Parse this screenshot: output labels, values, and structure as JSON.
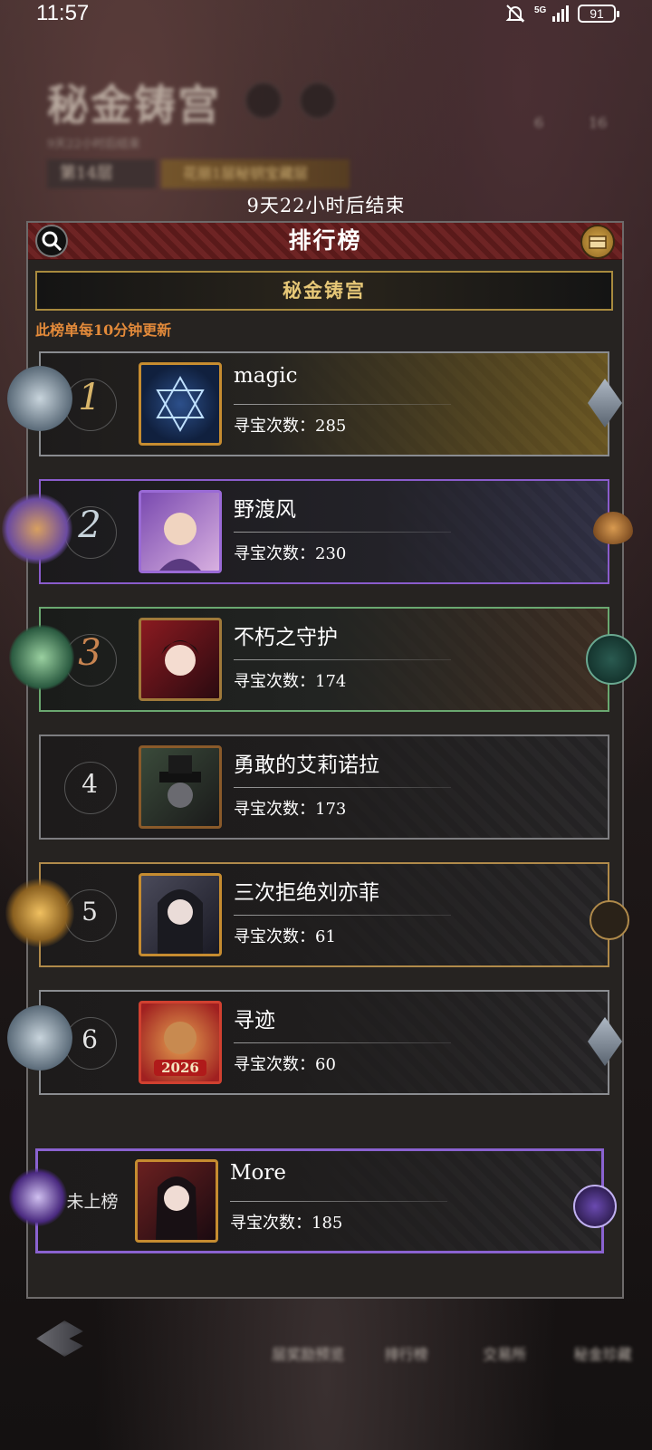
{
  "status": {
    "time": "11:57",
    "network": "5G",
    "battery": "91"
  },
  "background": {
    "title": "秘金铸宫",
    "subtitle": "9天22小时后结束",
    "floor": "第14层",
    "banner": "花丽1层秘钥宝藏层",
    "resource_1": "6",
    "resource_2": "16"
  },
  "countdown": "9天22小时后结束",
  "panel": {
    "title": "排行榜",
    "subtab": "秘金铸宫",
    "update_note": "此榜单每10分钟更新"
  },
  "rows": [
    {
      "rank": "1",
      "name": "magic",
      "score": "寻宝次数：285"
    },
    {
      "rank": "2",
      "name": "野渡风",
      "score": "寻宝次数：230"
    },
    {
      "rank": "3",
      "name": "不朽之守护",
      "score": "寻宝次数：174"
    },
    {
      "rank": "4",
      "name": "勇敢的艾莉诺拉",
      "score": "寻宝次数：173"
    },
    {
      "rank": "5",
      "name": "三次拒绝刘亦菲",
      "score": "寻宝次数：61"
    },
    {
      "rank": "6",
      "name": "寻迹",
      "score": "寻宝次数：60"
    }
  ],
  "self_row": {
    "rank": "未上榜",
    "name": "More",
    "score": "寻宝次数：185"
  },
  "avatar_badge": "2026",
  "bottom_nav": [
    "层奖励预览",
    "排行榜",
    "交易所",
    "秘金珍藏"
  ],
  "colors": {
    "gold": "#c69a3c",
    "purple": "#8a5ccc",
    "green": "#6aa870",
    "orange": "#e38a3a",
    "panel": "#262321"
  }
}
